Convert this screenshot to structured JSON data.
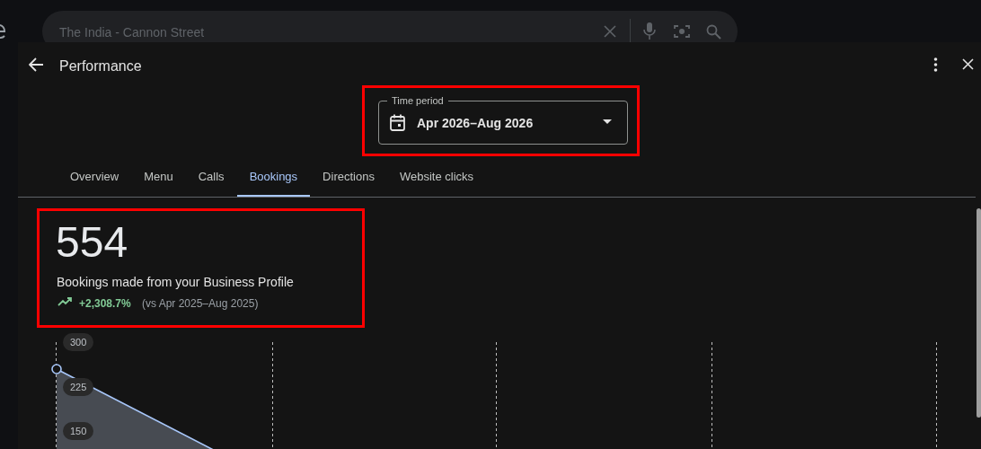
{
  "search": {
    "value": "The India - Cannon Street"
  },
  "dialog": {
    "title": "Performance"
  },
  "time_period": {
    "label": "Time period",
    "value": "Apr 2026–Aug 2026"
  },
  "tabs": [
    {
      "label": "Overview",
      "selected": false
    },
    {
      "label": "Menu",
      "selected": false
    },
    {
      "label": "Calls",
      "selected": false
    },
    {
      "label": "Bookings",
      "selected": true
    },
    {
      "label": "Directions",
      "selected": false
    },
    {
      "label": "Website clicks",
      "selected": false
    }
  ],
  "metric": {
    "value": "554",
    "description": "Bookings made from your Business Profile",
    "change": "+2,308.7%",
    "comparison": "(vs Apr 2025–Aug 2025)"
  },
  "chart": {
    "y_ticks": [
      "300",
      "225",
      "150"
    ]
  }
}
